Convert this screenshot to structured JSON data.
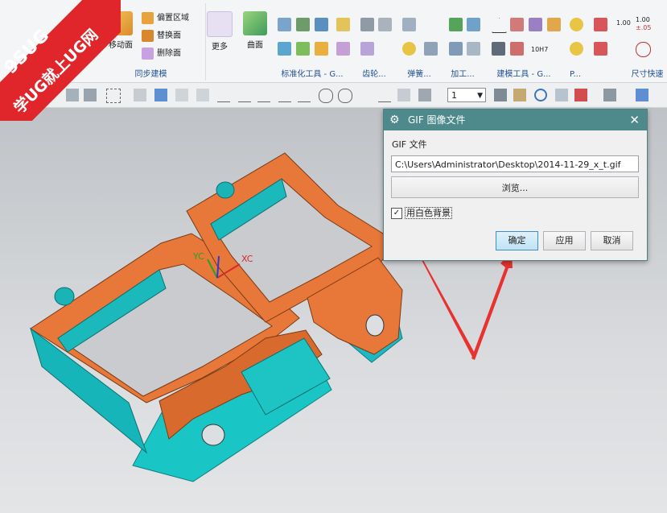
{
  "watermark": {
    "line1": "9SUG",
    "line2": "学UG就上UG网"
  },
  "ribbon": {
    "sync_group": {
      "move_face": "移动面",
      "offset_region": "偏置区域",
      "replace_face": "替换面",
      "delete_face": "删除面",
      "more": "更多",
      "label": "同步建模"
    },
    "surface": {
      "label": "曲面"
    },
    "groups": [
      "标准化工具 - G...",
      "齿轮...",
      "弹簧...",
      "加工...",
      "建模工具 - G...",
      "P...",
      "尺寸快速"
    ],
    "dim_text": [
      "1.00",
      "1.00",
      "±.05"
    ],
    "fit_text": "10H7"
  },
  "toolbar": {
    "selection_value": "1"
  },
  "dialog": {
    "title": "GIF 图像文件",
    "file_label": "GIF 文件",
    "path_value": "C:\\Users\\Administrator\\Desktop\\2014-11-29_x_t.gif",
    "browse": "浏览...",
    "white_bg_label": "用白色背景",
    "white_bg_checked": true,
    "ok": "确定",
    "apply": "应用",
    "cancel": "取消"
  },
  "axes": {
    "x": "XC",
    "y": "YC"
  },
  "colors": {
    "part_orange": "#e8783a",
    "part_cyan": "#1ac7c6",
    "dialog_title": "#4e8a8c",
    "arrow": "#e8322f"
  }
}
